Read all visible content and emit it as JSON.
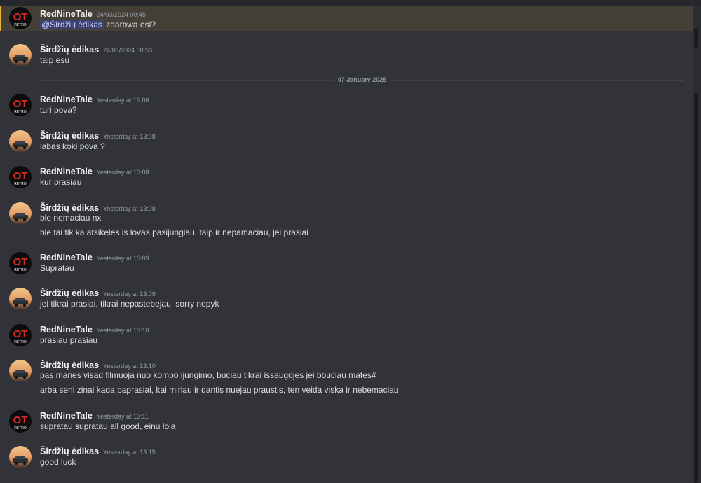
{
  "users": {
    "red": "RedNineTale",
    "sird": "Širdžių ėdikas"
  },
  "messages": [
    {
      "user": "RedNineTale",
      "time": "24/03/2024 00:45",
      "mention": "@Širdžių ėdikas",
      "lines": [
        "zdarowa esi?"
      ]
    },
    {
      "user": "Širdžių ėdikas",
      "time": "24/03/2024 00:53",
      "lines": [
        "taip esu"
      ]
    },
    {
      "user": "RedNineTale",
      "time": "Yesterday at 13:06",
      "lines": [
        "turi pova?"
      ]
    },
    {
      "user": "Širdžių ėdikas",
      "time": "Yesterday at 13:08",
      "lines": [
        "labas koki pova ?"
      ]
    },
    {
      "user": "RedNineTale",
      "time": "Yesterday at 13:08",
      "lines": [
        "kur prasiau"
      ]
    },
    {
      "user": "Širdžių ėdikas",
      "time": "Yesterday at 13:08",
      "lines": [
        "ble nemaciau nx",
        "ble tai tik ka atsikeles is lovas pasijungiau, taip ir nepamaciau, jei prasiai"
      ]
    },
    {
      "user": "RedNineTale",
      "time": "Yesterday at 13:09",
      "lines": [
        "Supratau"
      ]
    },
    {
      "user": "Širdžių ėdikas",
      "time": "Yesterday at 13:09",
      "lines": [
        "jei tikrai prasiai, tikrai nepastebejau, sorry nepyk"
      ]
    },
    {
      "user": "RedNineTale",
      "time": "Yesterday at 13:10",
      "lines": [
        "prasiau prasiau"
      ]
    },
    {
      "user": "Širdžių ėdikas",
      "time": "Yesterday at 13:10",
      "lines": [
        "pas manes visad filmuoja nuo kompo ijungimo, buciau tikrai issaugojes jei bbuciau mates#",
        "arba seni zinai kada paprasiai, kai miriau ir dantis nuejau praustis, ten veida viska ir nebemaciau"
      ]
    },
    {
      "user": "RedNineTale",
      "time": "Yesterday at 13:11",
      "lines": [
        "supratau supratau all good, einu lola"
      ]
    },
    {
      "user": "Širdžių ėdikas",
      "time": "Yesterday at 13:15",
      "lines": [
        "good luck"
      ]
    }
  ],
  "date_divider": "07 January 2025",
  "colors": {
    "background": "#313338",
    "highlight": "#444037",
    "highlight_bar": "#f0b232",
    "mention_bg": "#3c4270",
    "username": "#f2f3f5",
    "text": "#dbdee1",
    "timestamp": "#949ba4"
  },
  "icons": {
    "red_avatar": "ot-logo-avatar",
    "sird_avatar": "car-sunset-avatar"
  }
}
